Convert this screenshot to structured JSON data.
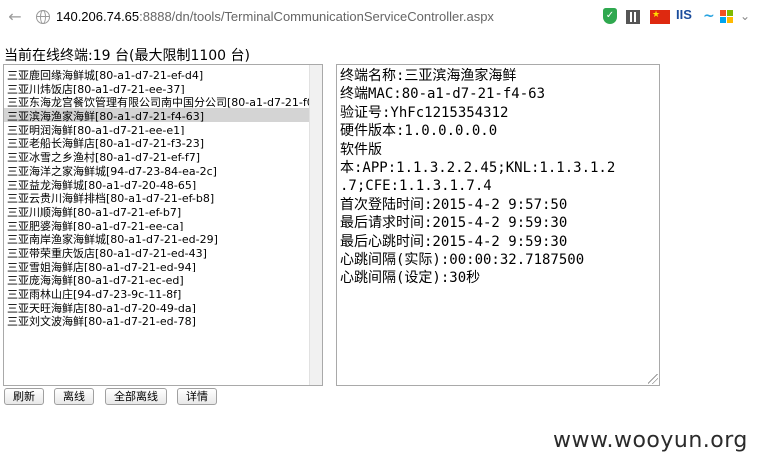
{
  "browser": {
    "url_host": "140.206.74.65",
    "url_path": ":8888/dn/tools/TerminalCommunicationServiceController.aspx",
    "extensions": [
      "shield-icon",
      "qr-code-icon",
      "china-flag-icon",
      "iis-icon",
      "windows-icon"
    ],
    "iis_label": "IIS"
  },
  "page": {
    "online_text": "当前在线终端:19 台(最大限制1100 台)"
  },
  "terminal_list": {
    "selected_index": 3,
    "items": [
      "三亚鹿回缘海鲜城[80-a1-d7-21-ef-d4]",
      "三亚川炜饭店[80-a1-d7-21-ee-37]",
      "三亚东海龙宫餐饮管理有限公司南中国分公司[80-a1-d7-21-f0-",
      "三亚滨海渔家海鲜[80-a1-d7-21-f4-63]",
      "三亚明润海鲜[80-a1-d7-21-ee-e1]",
      "三亚老船长海鲜店[80-a1-d7-21-f3-23]",
      "三亚冰雪之乡渔村[80-a1-d7-21-ef-f7]",
      "三亚海洋之家海鲜城[94-d7-23-84-ea-2c]",
      "三亚益龙海鲜城[80-a1-d7-20-48-65]",
      "三亚云贵川海鲜排档[80-a1-d7-21-ef-b8]",
      "三亚川顺海鲜[80-a1-d7-21-ef-b7]",
      "三亚肥婆海鲜[80-a1-d7-21-ee-ca]",
      "三亚南岸渔家海鲜城[80-a1-d7-21-ed-29]",
      "三亚带荣重庆饭店[80-a1-d7-21-ed-43]",
      "三亚雪姐海鲜店[80-a1-d7-21-ed-94]",
      "三亚庞海海鲜[80-a1-d7-21-ec-ed]",
      "三亚雨林山庄[94-d7-23-9c-11-8f]",
      "三亚天旺海鲜店[80-a1-d7-20-49-da]",
      "三亚刘文波海鲜[80-a1-d7-21-ed-78]"
    ]
  },
  "details": {
    "lines": [
      "终端名称:三亚滨海渔家海鲜",
      "终端MAC:80-a1-d7-21-f4-63",
      "验证号:YhFc1215354312",
      "硬件版本:1.0.0.0.0.0",
      "软件版",
      "本:APP:1.1.3.2.2.45;KNL:1.1.3.1.2",
      ".7;CFE:1.1.3.1.7.4",
      "首次登陆时间:2015-4-2 9:57:50",
      "最后请求时间:2015-4-2 9:59:30",
      "最后心跳时间:2015-4-2 9:59:30",
      "心跳间隔(实际):00:00:32.7187500",
      "心跳间隔(设定):30秒"
    ]
  },
  "buttons": {
    "refresh": "刷新",
    "offline": "离线",
    "all_offline": "全部离线",
    "details": "详情"
  },
  "watermark": "www.wooyun.org"
}
